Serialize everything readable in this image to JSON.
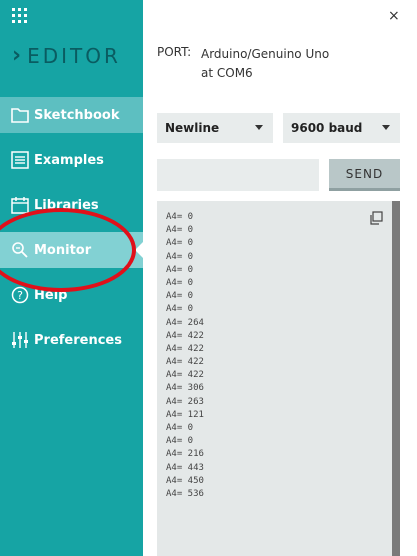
{
  "brand": {
    "title": "EDITOR"
  },
  "nav": [
    {
      "label": "Sketchbook",
      "icon": "folder-icon"
    },
    {
      "label": "Examples",
      "icon": "list-icon"
    },
    {
      "label": "Libraries",
      "icon": "calendar-icon"
    },
    {
      "label": "Monitor",
      "icon": "magnifier-icon"
    },
    {
      "label": "Help",
      "icon": "question-icon"
    },
    {
      "label": "Preferences",
      "icon": "sliders-icon"
    }
  ],
  "close": "×",
  "port": {
    "label": "PORT:",
    "board": "Arduino/Genuino Uno",
    "com": "at COM6"
  },
  "line_ending": {
    "selected": "Newline"
  },
  "baud": {
    "selected": "9600 baud"
  },
  "send": {
    "label": "SEND",
    "value": ""
  },
  "output": [
    "A4= 0",
    "A4= 0",
    "A4= 0",
    "A4= 0",
    "A4= 0",
    "A4= 0",
    "A4= 0",
    "A4= 0",
    "A4= 264",
    "A4= 422",
    "A4= 422",
    "A4= 422",
    "A4= 422",
    "A4= 306",
    "A4= 263",
    "A4= 121",
    "A4= 0",
    "A4= 0",
    "A4= 216",
    "A4= 443",
    "A4= 450",
    "A4= 536"
  ],
  "colors": {
    "sidebar": "#16a4a4",
    "active": "#5dbfc1",
    "highlight_circle": "#e0101a"
  }
}
